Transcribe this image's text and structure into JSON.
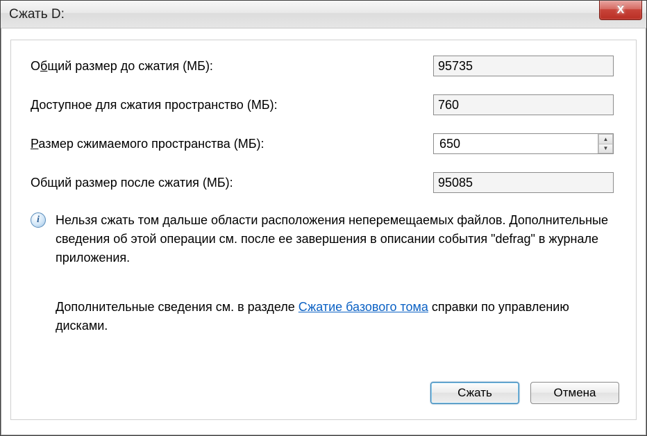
{
  "window": {
    "title": "Сжать D:"
  },
  "rows": {
    "total_before": {
      "label_pre": "О",
      "label_u": "б",
      "label_post": "щий размер до сжатия (МБ):",
      "value": "95735"
    },
    "available": {
      "label_pre": "",
      "label_u": "Д",
      "label_post": "оступное для сжатия пространство (МБ):",
      "value": "760"
    },
    "to_shrink": {
      "label_pre": "",
      "label_u": "Р",
      "label_post": "азмер сжимаемого пространства (МБ):",
      "value": "650"
    },
    "total_after": {
      "label": "Общий размер после сжатия (МБ):",
      "value": "95085"
    }
  },
  "info1": "Нельзя сжать том дальше области расположения неперемещаемых файлов. Дополнительные сведения об этой операции см. после ее завершения в описании события \"defrag\" в журнале приложения.",
  "info2_pre": "Дополнительные сведения см. в разделе ",
  "info2_link": "Сжатие базового тома",
  "info2_post": " справки по управлению дисками.",
  "buttons": {
    "ok": "Сжать",
    "cancel": "Отмена"
  },
  "close_glyph": "X"
}
